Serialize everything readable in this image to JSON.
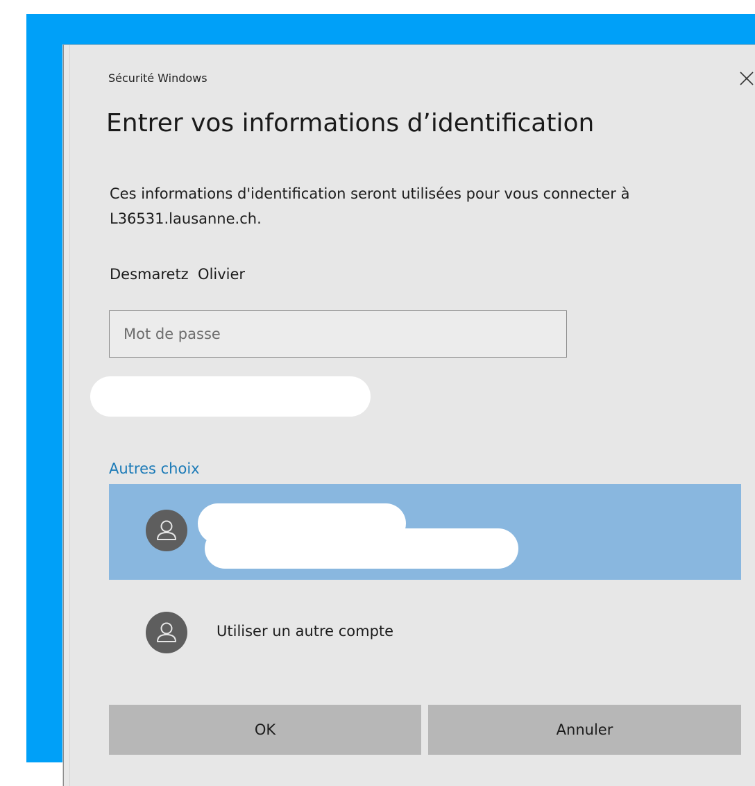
{
  "dialog": {
    "app_name": "Sécurité Windows",
    "title": "Entrer vos informations d’identification",
    "description": "Ces informations d'identification seront utilisées pour vous connecter à L36531.lausanne.ch.",
    "username": "Desmaretz  Olivier",
    "password": {
      "placeholder": "Mot de passe",
      "value": ""
    },
    "other_choices_label": "Autres choix",
    "accounts": [
      {
        "label": "",
        "selected": true,
        "icon": "user-icon"
      },
      {
        "label": "Utiliser un autre compte",
        "selected": false,
        "icon": "user-icon"
      }
    ],
    "buttons": {
      "ok": "OK",
      "cancel": "Annuler"
    },
    "close_icon": "close-icon"
  },
  "colors": {
    "desktop": "#00a0f8",
    "dialog_bg": "#e7e7e7",
    "selected_row": "#89b7df",
    "link": "#1b7ab7",
    "button": "#b7b7b7",
    "avatar": "#5e5e5e"
  }
}
